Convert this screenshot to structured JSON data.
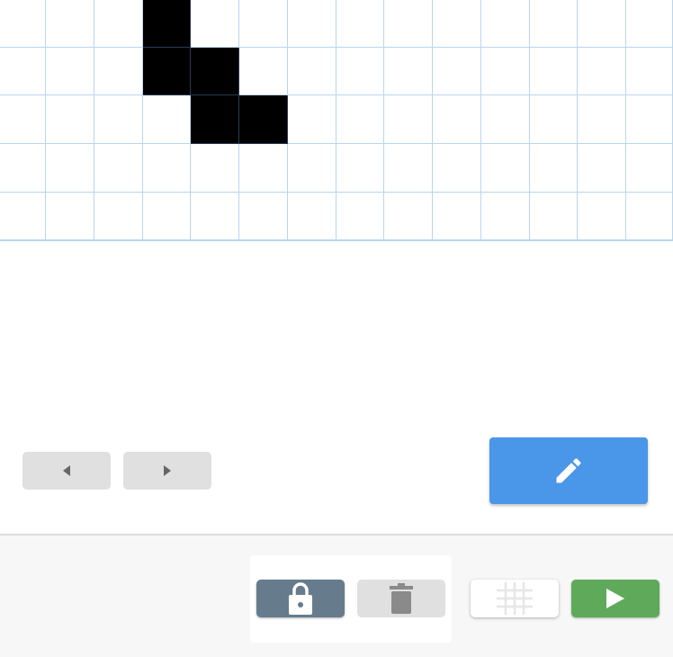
{
  "canvas": {
    "rows": 5,
    "cols": 14,
    "filled": [
      [
        0,
        3
      ],
      [
        1,
        3
      ],
      [
        1,
        4
      ],
      [
        2,
        4
      ],
      [
        2,
        5
      ]
    ]
  },
  "colors": {
    "accent_blue": "#4a96e8",
    "play_green": "#5faa5a",
    "lock_slate": "#667c8d",
    "grid_line": "#b9d6ef"
  },
  "icons": {
    "prev": "triangle-left-icon",
    "next": "triangle-right-icon",
    "edit": "pencil-icon",
    "lock": "lock-icon",
    "delete": "trash-icon",
    "grid": "grid-icon",
    "run": "play-icon"
  }
}
